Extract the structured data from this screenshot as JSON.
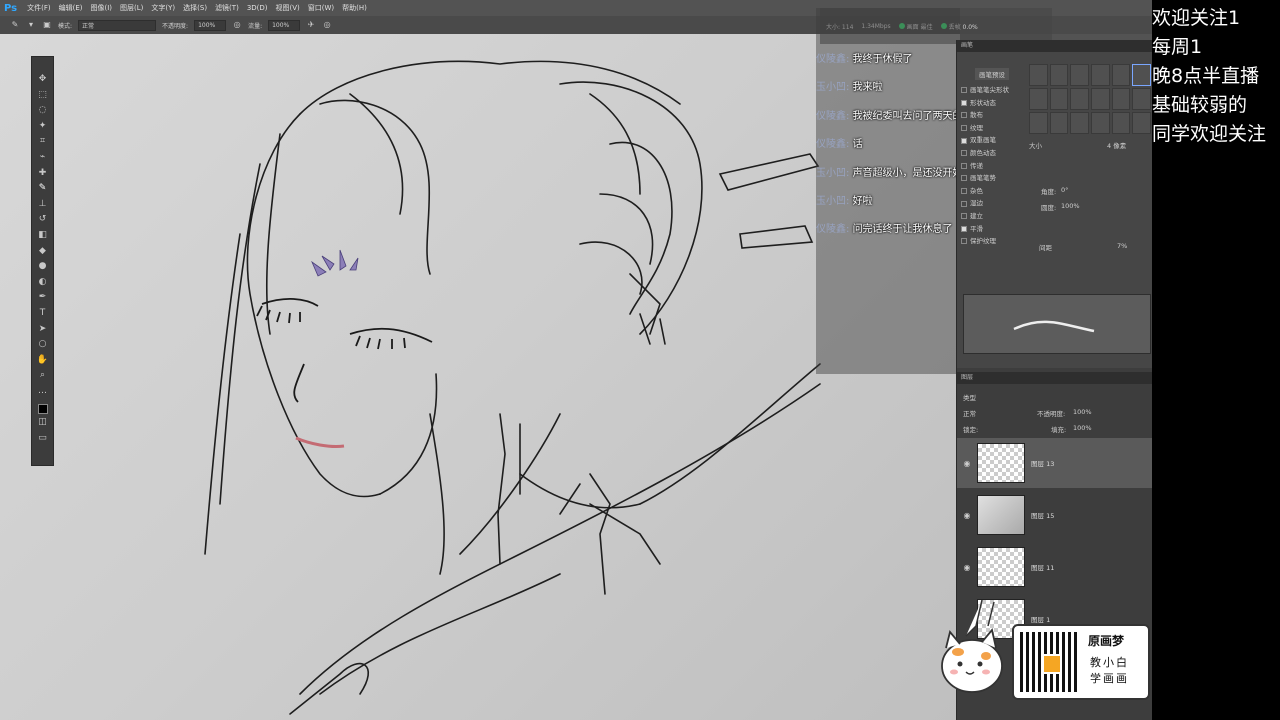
{
  "app": {
    "logo": "Ps",
    "menu": [
      "文件(F)",
      "编辑(E)",
      "图像(I)",
      "图层(L)",
      "文字(Y)",
      "选择(S)",
      "滤镜(T)",
      "3D(D)",
      "视图(V)",
      "窗口(W)",
      "帮助(H)"
    ]
  },
  "options_bar": {
    "mode_label": "模式:",
    "mode_value": "正常",
    "opacity_label": "不透明度:",
    "opacity_value": "100%",
    "flow_label": "流量:",
    "flow_value": "100%"
  },
  "floater": {
    "size_label": "大小: 114",
    "rate": "1.34Mbps",
    "status_a": "画面 最佳",
    "status_b": "丢帧 0.0%"
  },
  "chat": [
    {
      "user": "仪陵鑫:",
      "msg": "我终于休假了"
    },
    {
      "user": "玉小凹:",
      "msg": "我来啦"
    },
    {
      "user": "仪陵鑫:",
      "msg": "我被纪委叫去问了两天的画"
    },
    {
      "user": "仪陵鑫:",
      "msg": "话"
    },
    {
      "user": "玉小凹:",
      "msg": "声音超级小，是还没开始吧"
    },
    {
      "user": "玉小凹:",
      "msg": "好啦"
    },
    {
      "user": "仪陵鑫:",
      "msg": "问完话终于让我休息了"
    }
  ],
  "brush_panel": {
    "tab": "画笔",
    "preset_button": "画笔预设",
    "items": [
      {
        "label": "画笔笔尖形状",
        "checked": false
      },
      {
        "label": "形状动态",
        "checked": true
      },
      {
        "label": "散布",
        "checked": false
      },
      {
        "label": "纹理",
        "checked": false
      },
      {
        "label": "双重画笔",
        "checked": true
      },
      {
        "label": "颜色动态",
        "checked": false
      },
      {
        "label": "传递",
        "checked": false
      },
      {
        "label": "画笔笔势",
        "checked": false
      },
      {
        "label": "杂色",
        "checked": false
      },
      {
        "label": "湿边",
        "checked": false
      },
      {
        "label": "建立",
        "checked": false
      },
      {
        "label": "平滑",
        "checked": true
      },
      {
        "label": "保护纹理",
        "checked": false
      }
    ],
    "size_label": "大小",
    "size_value": "4 像素",
    "angle_label": "角度:",
    "angle_value": "0°",
    "roundness_label": "圆度:",
    "roundness_value": "100%",
    "spacing_label": "间距",
    "spacing_value": "7%"
  },
  "layers_panel": {
    "tab": "图层",
    "kind_label": "类型",
    "blend": "正常",
    "opacity_label": "不透明度:",
    "opacity_value": "100%",
    "lock_label": "锁定:",
    "fill_label": "填充:",
    "fill_value": "100%",
    "layers": [
      {
        "name": "图层 13",
        "active": true
      },
      {
        "name": "图层 15",
        "active": false
      },
      {
        "name": "图层 11",
        "active": false
      },
      {
        "name": "图层 1",
        "active": false
      }
    ]
  },
  "promo": {
    "title": "原画梦",
    "line1": "教小白",
    "line2": "学画画"
  },
  "info_panel": {
    "lines": [
      "欢迎关注1",
      "每周1",
      "晚8点半直播",
      "基础较弱的",
      "同学欢迎关注"
    ]
  },
  "colors": {
    "ps_blue": "#31a8ff",
    "panel_bg": "#3d3d3d",
    "chat_user": "#9ba9cf"
  }
}
